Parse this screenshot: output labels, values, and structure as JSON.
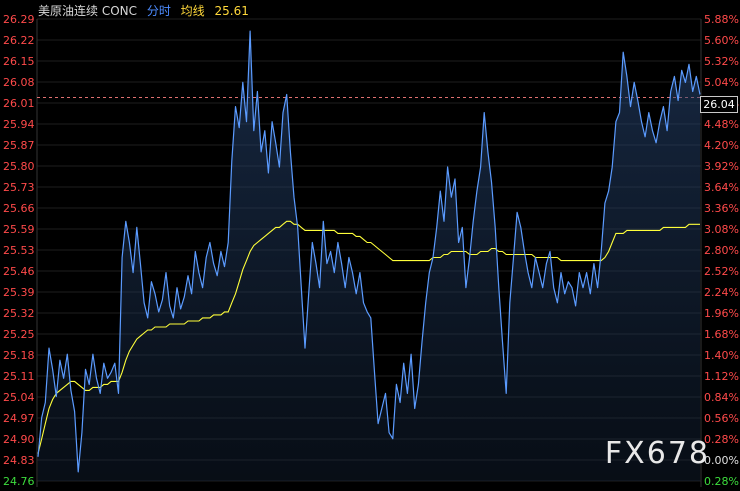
{
  "header": {
    "symbol": "美原油连续 CONC",
    "mode": "分时",
    "avg_label": "均线",
    "avg_value": "25.61"
  },
  "watermark": "FX678",
  "last_price": "26.04",
  "colors": {
    "price_line": "#5b9bff",
    "avg_line": "#ffff3a",
    "left_axis": "#ff4a4a",
    "right_up": "#ff4a4a",
    "right_zero": "#e0e0e0",
    "right_down": "#3ddc3d",
    "grid": "#1e1e1e",
    "ref_line": "#e07070"
  },
  "chart_data": {
    "type": "line",
    "y_left_ticks": [
      "26.29",
      "26.22",
      "26.15",
      "26.08",
      "26.01",
      "25.94",
      "25.87",
      "25.80",
      "25.73",
      "25.66",
      "25.59",
      "25.53",
      "25.46",
      "25.39",
      "25.32",
      "25.25",
      "25.18",
      "25.11",
      "25.04",
      "24.97",
      "24.90",
      "24.83",
      "24.76"
    ],
    "y_right_ticks": [
      "5.88%",
      "5.60%",
      "5.32%",
      "5.04%",
      "4.76%",
      "4.48%",
      "4.20%",
      "3.92%",
      "3.64%",
      "3.36%",
      "3.08%",
      "2.80%",
      "2.52%",
      "2.24%",
      "1.96%",
      "1.68%",
      "1.40%",
      "1.12%",
      "0.84%",
      "0.56%",
      "0.28%",
      "0.00%",
      "0.28%"
    ],
    "ylim": [
      24.76,
      26.29
    ],
    "reference_price": 26.03,
    "series": [
      {
        "role": "price",
        "values": [
          24.84,
          24.97,
          25.02,
          25.2,
          25.13,
          25.04,
          25.16,
          25.1,
          25.18,
          25.06,
          24.99,
          24.79,
          24.92,
          25.13,
          25.08,
          25.18,
          25.1,
          25.05,
          25.15,
          25.1,
          25.12,
          25.15,
          25.05,
          25.5,
          25.62,
          25.55,
          25.45,
          25.6,
          25.48,
          25.35,
          25.3,
          25.42,
          25.38,
          25.32,
          25.36,
          25.45,
          25.34,
          25.3,
          25.4,
          25.33,
          25.37,
          25.44,
          25.38,
          25.52,
          25.45,
          25.4,
          25.5,
          25.55,
          25.48,
          25.44,
          25.52,
          25.47,
          25.55,
          25.82,
          26.0,
          25.93,
          26.08,
          25.95,
          26.25,
          25.92,
          26.05,
          25.85,
          25.92,
          25.78,
          25.95,
          25.88,
          25.8,
          25.98,
          26.04,
          25.85,
          25.7,
          25.6,
          25.4,
          25.2,
          25.38,
          25.55,
          25.48,
          25.4,
          25.62,
          25.48,
          25.52,
          25.45,
          25.55,
          25.48,
          25.4,
          25.5,
          25.45,
          25.38,
          25.45,
          25.35,
          25.32,
          25.3,
          25.12,
          24.95,
          25.0,
          25.05,
          24.92,
          24.9,
          25.08,
          25.02,
          25.15,
          25.05,
          25.18,
          25.0,
          25.08,
          25.22,
          25.35,
          25.45,
          25.5,
          25.6,
          25.72,
          25.62,
          25.8,
          25.7,
          25.76,
          25.55,
          25.6,
          25.4,
          25.5,
          25.62,
          25.72,
          25.8,
          25.98,
          25.85,
          25.75,
          25.6,
          25.4,
          25.22,
          25.05,
          25.35,
          25.5,
          25.65,
          25.6,
          25.52,
          25.45,
          25.4,
          25.5,
          25.45,
          25.4,
          25.48,
          25.52,
          25.4,
          25.35,
          25.45,
          25.38,
          25.42,
          25.4,
          25.34,
          25.45,
          25.4,
          25.45,
          25.38,
          25.48,
          25.4,
          25.52,
          25.68,
          25.72,
          25.8,
          25.95,
          25.98,
          26.18,
          26.1,
          26.0,
          26.08,
          26.02,
          25.95,
          25.9,
          25.98,
          25.92,
          25.88,
          25.95,
          26.0,
          25.92,
          26.05,
          26.1,
          26.02,
          26.12,
          26.08,
          26.14,
          26.05,
          26.1,
          26.04
        ]
      },
      {
        "role": "average",
        "values": [
          24.85,
          24.9,
          24.95,
          25.0,
          25.03,
          25.05,
          25.06,
          25.07,
          25.08,
          25.09,
          25.09,
          25.08,
          25.07,
          25.06,
          25.06,
          25.07,
          25.07,
          25.07,
          25.08,
          25.08,
          25.09,
          25.09,
          25.09,
          25.12,
          25.16,
          25.19,
          25.21,
          25.23,
          25.24,
          25.25,
          25.26,
          25.26,
          25.27,
          25.27,
          25.27,
          25.27,
          25.28,
          25.28,
          25.28,
          25.28,
          25.28,
          25.29,
          25.29,
          25.29,
          25.29,
          25.3,
          25.3,
          25.3,
          25.31,
          25.31,
          25.31,
          25.32,
          25.32,
          25.35,
          25.38,
          25.42,
          25.46,
          25.49,
          25.52,
          25.54,
          25.55,
          25.56,
          25.57,
          25.58,
          25.59,
          25.6,
          25.6,
          25.61,
          25.62,
          25.62,
          25.61,
          25.61,
          25.6,
          25.59,
          25.59,
          25.59,
          25.59,
          25.59,
          25.59,
          25.59,
          25.59,
          25.59,
          25.58,
          25.58,
          25.58,
          25.58,
          25.58,
          25.57,
          25.57,
          25.56,
          25.55,
          25.55,
          25.54,
          25.53,
          25.52,
          25.51,
          25.5,
          25.49,
          25.49,
          25.49,
          25.49,
          25.49,
          25.49,
          25.49,
          25.49,
          25.49,
          25.49,
          25.49,
          25.5,
          25.5,
          25.5,
          25.51,
          25.51,
          25.52,
          25.52,
          25.52,
          25.52,
          25.52,
          25.51,
          25.51,
          25.51,
          25.52,
          25.52,
          25.52,
          25.53,
          25.53,
          25.52,
          25.52,
          25.51,
          25.51,
          25.51,
          25.51,
          25.51,
          25.51,
          25.51,
          25.51,
          25.5,
          25.5,
          25.5,
          25.5,
          25.5,
          25.5,
          25.5,
          25.49,
          25.49,
          25.49,
          25.49,
          25.49,
          25.49,
          25.49,
          25.49,
          25.49,
          25.49,
          25.49,
          25.49,
          25.5,
          25.52,
          25.55,
          25.58,
          25.58,
          25.58,
          25.59,
          25.59,
          25.59,
          25.59,
          25.59,
          25.59,
          25.59,
          25.59,
          25.59,
          25.59,
          25.6,
          25.6,
          25.6,
          25.6,
          25.6,
          25.6,
          25.6,
          25.61,
          25.61,
          25.61,
          25.61
        ]
      }
    ]
  }
}
